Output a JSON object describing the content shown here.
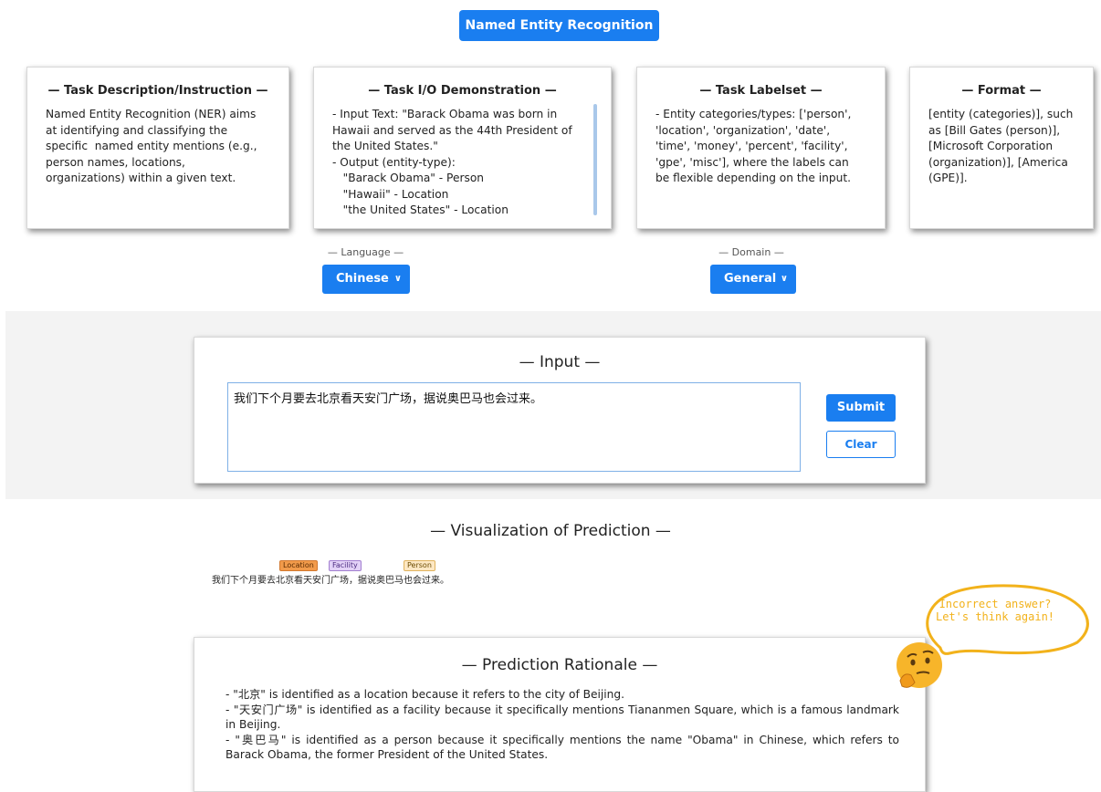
{
  "header": {
    "title": "Named Entity Recognition"
  },
  "cards": [
    {
      "title": "— Task Description/Instruction —",
      "body": "Named Entity Recognition (NER) aims\nat identifying and classifying the\nspecific  named entity mentions (e.g.,\nperson names, locations,\norganizations) within a given text."
    },
    {
      "title": "— Task I/O Demonstration —",
      "body": "- Input Text: \"Barack Obama was born in\nHawaii and served as the 44th President of\nthe United States.\"\n- Output (entity-type):\n   \"Barack Obama\" - Person\n   \"Hawaii\" - Location\n   \"the United States\" - Location"
    },
    {
      "title": "— Task Labelset —",
      "body": "- Entity categories/types: ['person',\n'location', 'organization', 'date',\n'time', 'money', 'percent', 'facility',\n'gpe', 'misc'], where the labels can\nbe flexible depending on the input."
    },
    {
      "title": "— Format —",
      "body": "[entity (categories)], such\nas [Bill Gates (person)],\n[Microsoft Corporation\n(organization)], [America\n(GPE)]."
    }
  ],
  "selectors": {
    "language": {
      "label": "— Language —",
      "value": "Chinese"
    },
    "domain": {
      "label": "— Domain —",
      "value": "General"
    }
  },
  "input": {
    "title": "— Input —",
    "text": "我们下个月要去北京看天安门广场，据说奥巴马也会过来。",
    "submit_label": "Submit",
    "clear_label": "Clear"
  },
  "visualization": {
    "title": "— Visualization of Prediction —",
    "text": "我们下个月要去北京看天安门广场，据说奥巴马也会过来。",
    "tags": [
      {
        "label": "Location",
        "color": "#f29b4b",
        "border": "#d2782e"
      },
      {
        "label": "Facility",
        "color": "#e3d2f7",
        "border": "#a27fd0"
      },
      {
        "label": "Person",
        "color": "#fde8c4",
        "border": "#e0b35e"
      }
    ]
  },
  "bubble": {
    "line1": "Incorrect answer?",
    "line2": "Let's think again!",
    "color": "#f2b21b"
  },
  "rationale": {
    "title": "— Prediction Rationale —",
    "lines": [
      "- \"北京\" is identified as a location because it refers to the city of Beijing.",
      "- \"天安门广场\" is identified as a facility because it specifically mentions Tiananmen Square, which is a famous landmark in Beijing.",
      "- \"奥巴马\" is identified as a person because it specifically mentions the name \"Obama\" in Chinese, which refers to Barack Obama, the former President of the United States."
    ]
  },
  "colors": {
    "accent": "#1a7ef0",
    "band": "#f3f3f3"
  }
}
